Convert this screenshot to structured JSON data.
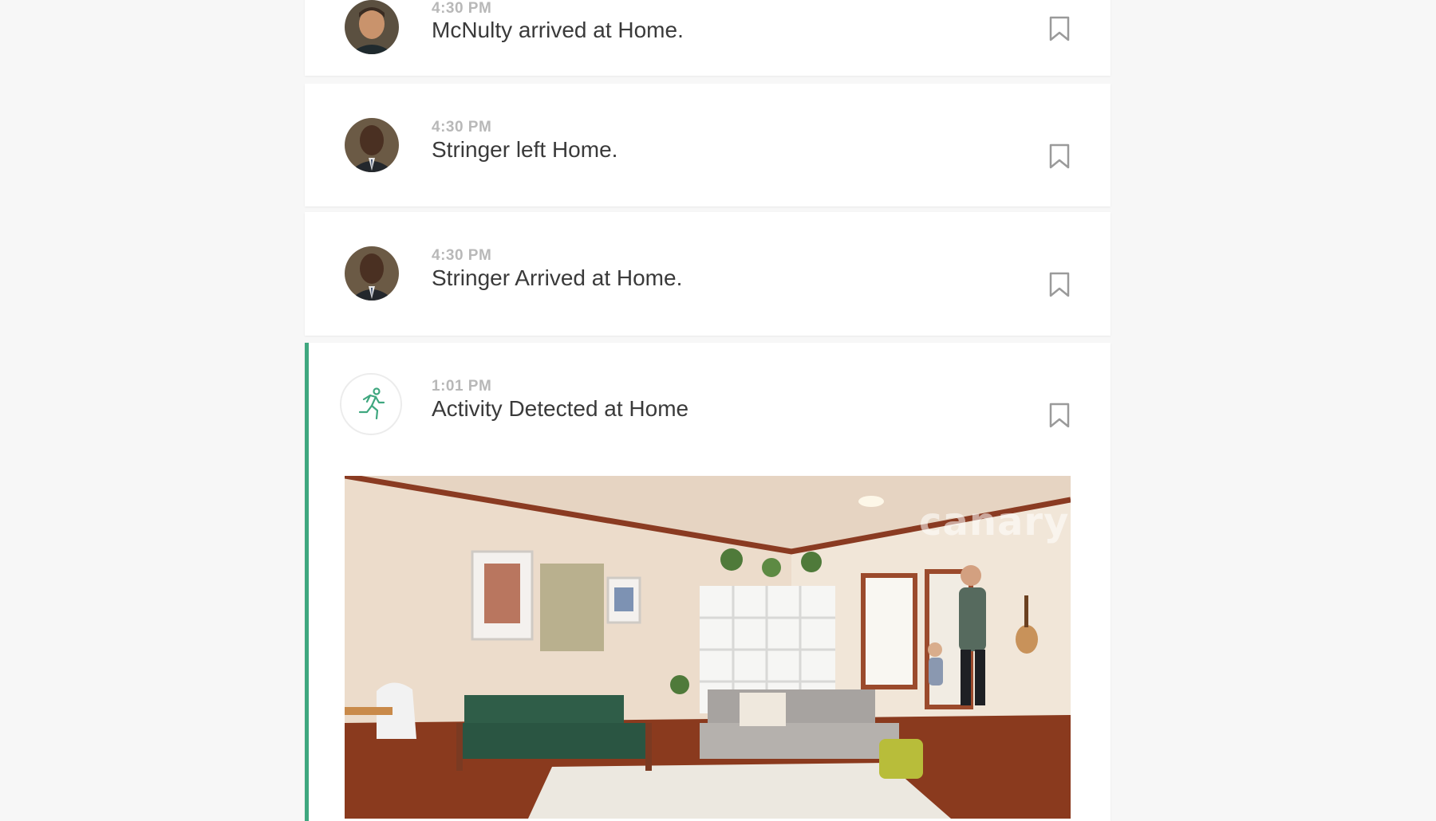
{
  "feed": {
    "events": [
      {
        "time": "4:30 PM",
        "title": "McNulty arrived at Home.",
        "avatar": "person-avatar-mcnulty"
      },
      {
        "time": "4:30 PM",
        "title": "Stringer left Home.",
        "avatar": "person-avatar-stringer"
      },
      {
        "time": "4:30 PM",
        "title": "Stringer Arrived at Home.",
        "avatar": "person-avatar-stringer"
      },
      {
        "time": "1:01 PM",
        "title": "Activity Detected at Home",
        "avatar": "running-person-icon"
      }
    ],
    "snapshot_watermark": "canary",
    "accent_color": "#3fa77f"
  }
}
